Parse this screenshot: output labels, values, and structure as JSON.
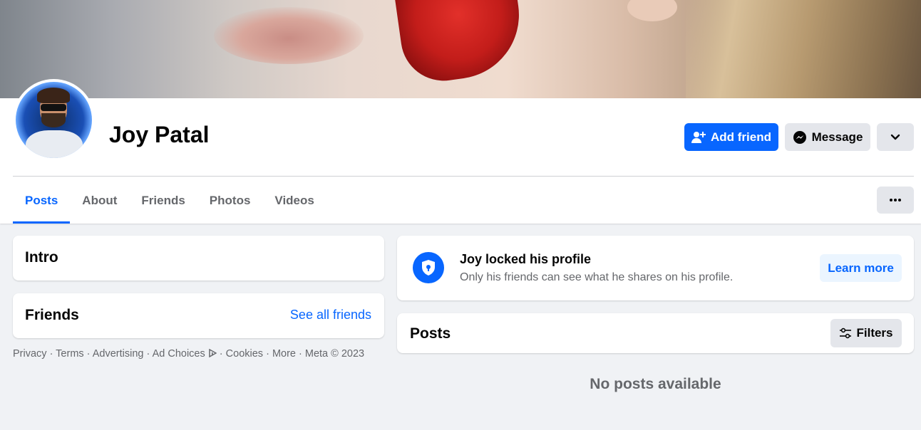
{
  "profile": {
    "name": "Joy Patal",
    "add_friend_label": "Add friend",
    "message_label": "Message"
  },
  "tabs": [
    "Posts",
    "About",
    "Friends",
    "Photos",
    "Videos"
  ],
  "intro": {
    "title": "Intro"
  },
  "friends": {
    "title": "Friends",
    "see_all": "See all friends"
  },
  "footer": {
    "links": [
      "Privacy",
      "Terms",
      "Advertising",
      "Ad Choices",
      "Cookies",
      "More",
      "Meta © 2023"
    ]
  },
  "locked": {
    "title": "Joy locked his profile",
    "subtitle": "Only his friends can see what he shares on his profile.",
    "learn_more": "Learn more"
  },
  "posts": {
    "title": "Posts",
    "filters_label": "Filters",
    "empty_text": "No posts available"
  },
  "colors": {
    "primary": "#0866ff",
    "background": "#f0f2f5",
    "secondary_text": "#65676b"
  }
}
